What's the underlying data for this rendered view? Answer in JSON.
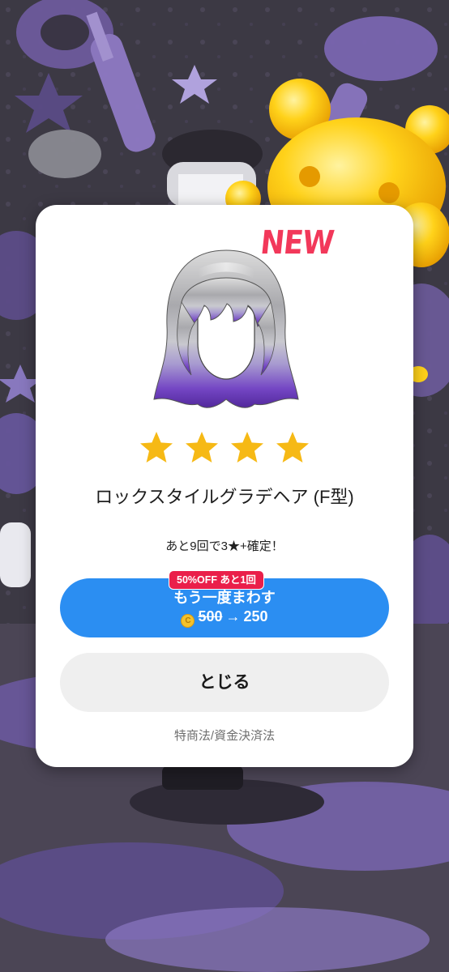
{
  "modal": {
    "badge": "NEW",
    "item_image_icon": "hair-item-icon",
    "rarity_stars": 4,
    "item_name": "ロックスタイルグラデヘア (F型)",
    "pity_text": "あと9回で3★+確定！",
    "discount_badge": "50%OFF あと1回",
    "spin_button": {
      "label": "もう一度まわす",
      "coin_icon": "coin-icon",
      "old_price": "500",
      "arrow": "→",
      "new_price": "250"
    },
    "close_button": "とじる",
    "legal_link": "特商法/資金決済法"
  },
  "colors": {
    "accent_blue": "#2b8ef2",
    "badge_red": "#ea1f4a",
    "new_red": "#f2385a",
    "star_yellow": "#f6b915",
    "hair_purple": "#6a3fb0"
  }
}
